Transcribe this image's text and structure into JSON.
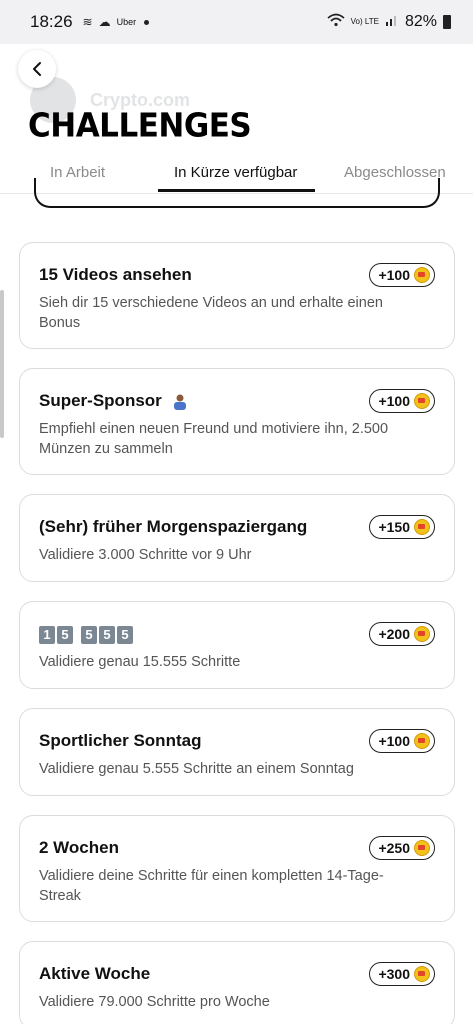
{
  "status_bar": {
    "time": "18:26",
    "app_label": "Uber",
    "network": "Vo) LTE",
    "battery": "82%"
  },
  "background_header": {
    "brand": "Crypto.com"
  },
  "header": {
    "title": "CHALLENGES"
  },
  "tabs": [
    {
      "label": "In Arbeit",
      "active": false
    },
    {
      "label": "In Kürze verfügbar",
      "active": true
    },
    {
      "label": "Abgeschlossen",
      "active": false
    }
  ],
  "challenges": [
    {
      "title": "15 Videos ansehen",
      "description": "Sieh dir 15 verschiedene Videos an und erhalte einen Bonus",
      "reward": "+100"
    },
    {
      "title": "Super-Sponsor",
      "description": "Empfiehl einen neuen Freund und motiviere ihn, 2.500 Münzen zu sammeln",
      "reward": "+100"
    },
    {
      "title": "(Sehr) früher Morgenspaziergang",
      "description": "Validiere 3.000 Schritte vor 9 Uhr",
      "reward": "+150"
    },
    {
      "title": "15555",
      "title_digits": [
        "1",
        "5",
        "5",
        "5",
        "5"
      ],
      "description": "Validiere genau 15.555 Schritte",
      "reward": "+200"
    },
    {
      "title": "Sportlicher Sonntag",
      "description": "Validiere genau 5.555 Schritte an einem Sonntag",
      "reward": "+100"
    },
    {
      "title": "2 Wochen",
      "description": "Validiere deine Schritte für einen kompletten 14-Tage-Streak",
      "reward": "+250"
    },
    {
      "title": "Aktive Woche",
      "description": "Validiere 79.000 Schritte pro Woche",
      "reward": "+300"
    }
  ],
  "colors": {
    "coin": "#f2c21a",
    "active_tab": "#111111",
    "inactive_tab": "#8a8a8a"
  }
}
